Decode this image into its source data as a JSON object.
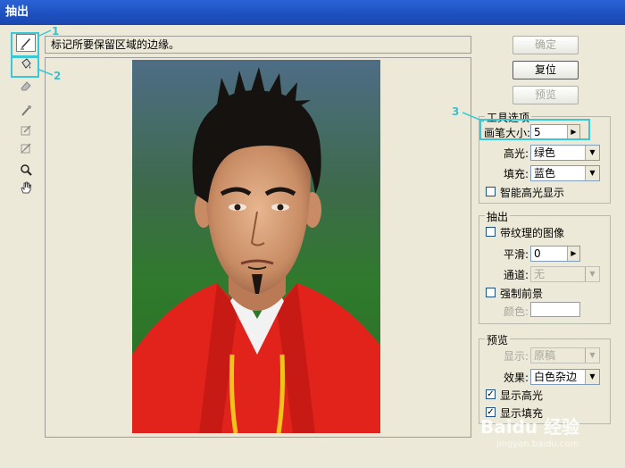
{
  "window": {
    "title": "抽出"
  },
  "tools": [
    {
      "name": "edge-highlighter-icon"
    },
    {
      "name": "fill-bucket-icon"
    },
    {
      "name": "eraser-icon"
    },
    {
      "name": "eyedropper-icon"
    },
    {
      "name": "cleanup-tool-icon"
    },
    {
      "name": "edge-touchup-icon"
    },
    {
      "name": "zoom-icon"
    },
    {
      "name": "hand-icon"
    }
  ],
  "hint": "标记所要保留区域的边缘。",
  "buttons": {
    "ok": "确定",
    "reset": "复位",
    "preview": "预览"
  },
  "tool_options": {
    "title": "工具选项",
    "brush_size_label": "画笔大小:",
    "brush_size_value": "5",
    "highlight_label": "高光:",
    "highlight_value": "绿色",
    "fill_label": "填充:",
    "fill_value": "蓝色",
    "smart_highlight_label": "智能高光显示"
  },
  "extraction": {
    "title": "抽出",
    "textured_label": "带纹理的图像",
    "smooth_label": "平滑:",
    "smooth_value": "0",
    "channel_label": "通道:",
    "channel_value": "无",
    "force_fg_label": "强制前景",
    "color_label": "颜色:"
  },
  "preview": {
    "title": "预览",
    "show_label": "显示:",
    "show_value": "原稿",
    "effect_label": "效果:",
    "effect_value": "白色杂边",
    "show_highlight_label": "显示高光",
    "show_fill_label": "显示填充"
  },
  "annotations": {
    "a1": "1",
    "a2": "2",
    "a3": "3"
  },
  "watermark": {
    "main": "Baidu 经验",
    "sub": "jingyan.baidu.com"
  },
  "colors": {
    "titlebar": "#1d4fbf",
    "annotation": "#3bc8d6",
    "dialog": "#ece9d8"
  }
}
